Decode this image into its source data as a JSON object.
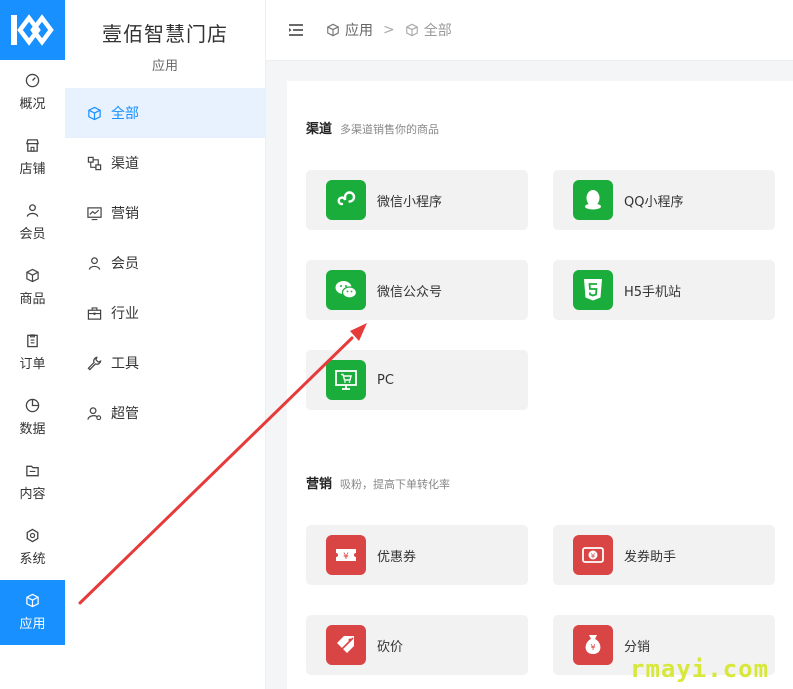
{
  "rail": {
    "items": [
      {
        "label": "概况",
        "icon": "dashboard-icon"
      },
      {
        "label": "店铺",
        "icon": "store-icon"
      },
      {
        "label": "会员",
        "icon": "user-icon"
      },
      {
        "label": "商品",
        "icon": "cube-icon"
      },
      {
        "label": "订单",
        "icon": "clipboard-icon"
      },
      {
        "label": "数据",
        "icon": "pie-icon"
      },
      {
        "label": "内容",
        "icon": "folder-icon"
      },
      {
        "label": "系统",
        "icon": "gear-icon"
      },
      {
        "label": "应用",
        "icon": "cube-icon",
        "active": true
      }
    ]
  },
  "sub": {
    "store_name": "壹佰智慧门店",
    "section": "应用",
    "items": [
      {
        "label": "全部",
        "icon": "cube-icon",
        "active": true
      },
      {
        "label": "渠道",
        "icon": "channel-icon"
      },
      {
        "label": "营销",
        "icon": "monitor-chart-icon"
      },
      {
        "label": "会员",
        "icon": "user-icon"
      },
      {
        "label": "行业",
        "icon": "briefcase-icon"
      },
      {
        "label": "工具",
        "icon": "wrench-icon"
      },
      {
        "label": "超管",
        "icon": "admin-icon"
      }
    ]
  },
  "breadcrumb": {
    "items": [
      "应用",
      "全部"
    ],
    "sep": ">"
  },
  "sections": {
    "channel": {
      "title": "渠道",
      "desc": "多渠道销售你的商品",
      "cards": [
        {
          "label": "微信小程序",
          "icon": "mini-program-icon",
          "color": "#1aad3c"
        },
        {
          "label": "QQ小程序",
          "icon": "qq-icon",
          "color": "#1aad3c"
        },
        {
          "label": "微信公众号",
          "icon": "wechat-icon",
          "color": "#1aad3c"
        },
        {
          "label": "H5手机站",
          "icon": "html5-icon",
          "color": "#1aad3c"
        },
        {
          "label": "PC",
          "icon": "pc-cart-icon",
          "color": "#1aad3c"
        }
      ]
    },
    "marketing": {
      "title": "营销",
      "desc": "吸粉，提高下单转化率",
      "cards": [
        {
          "label": "优惠券",
          "icon": "coupon-icon",
          "color": "#d94444"
        },
        {
          "label": "发券助手",
          "icon": "coupon-assistant-icon",
          "color": "#d94444"
        },
        {
          "label": "砍价",
          "icon": "bargain-icon",
          "color": "#d94444"
        },
        {
          "label": "分销",
          "icon": "money-bag-icon",
          "color": "#d94444"
        }
      ]
    }
  },
  "watermark": "rmayi.com",
  "colors": {
    "accent": "#1890ff",
    "green": "#1aad3c",
    "red": "#d94444",
    "arrow": "#e63b3b"
  }
}
